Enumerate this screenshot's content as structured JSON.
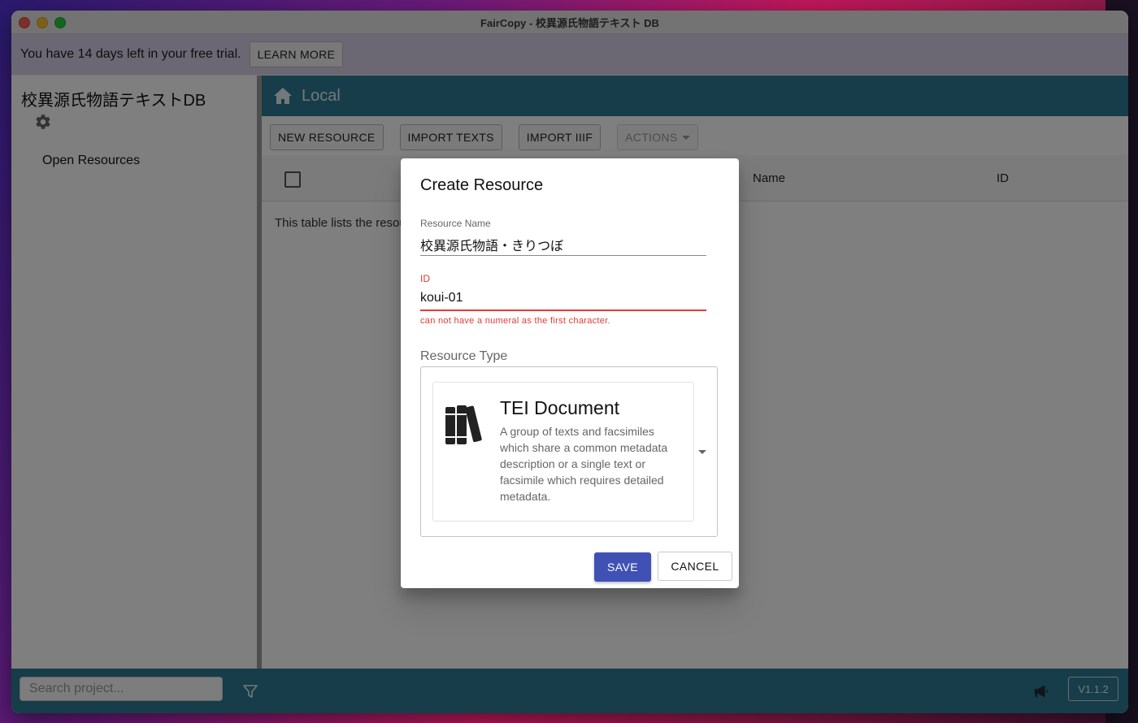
{
  "window": {
    "title": "FairCopy - 校異源氏物語テキスト DB"
  },
  "trial": {
    "message": "You have 14 days left in your free trial.",
    "learn_more": "LEARN MORE"
  },
  "sidebar": {
    "project_title": "校異源氏物語テキストDB",
    "open_resources": "Open Resources"
  },
  "main": {
    "header_label": "Local",
    "toolbar": {
      "new_resource": "NEW RESOURCE",
      "import_texts": "IMPORT TEXTS",
      "import_iiif": "IMPORT IIIF",
      "actions": "ACTIONS"
    },
    "table": {
      "columns": [
        "Name",
        "ID"
      ],
      "description": "This table lists the resources"
    }
  },
  "footer": {
    "search_placeholder": "Search project...",
    "version": "V1.1.2"
  },
  "dialog": {
    "title": "Create Resource",
    "resource_name_label": "Resource Name",
    "resource_name_value": "校異源氏物語・きりつぼ",
    "id_label": "ID",
    "id_value": "koui-01",
    "id_error": "can not have a numeral as the first character.",
    "resource_type_label": "Resource Type",
    "resource_type": {
      "name": "TEI Document",
      "description": "A group of texts and facsimiles which share a common metadata description or a single text or facsimile which requires detailed metadata."
    },
    "save": "SAVE",
    "cancel": "CANCEL"
  },
  "colors": {
    "header_teal": "#2d7a93",
    "primary": "#3f51b5",
    "error": "#e53935",
    "trial_bar": "#d6d0e8"
  }
}
